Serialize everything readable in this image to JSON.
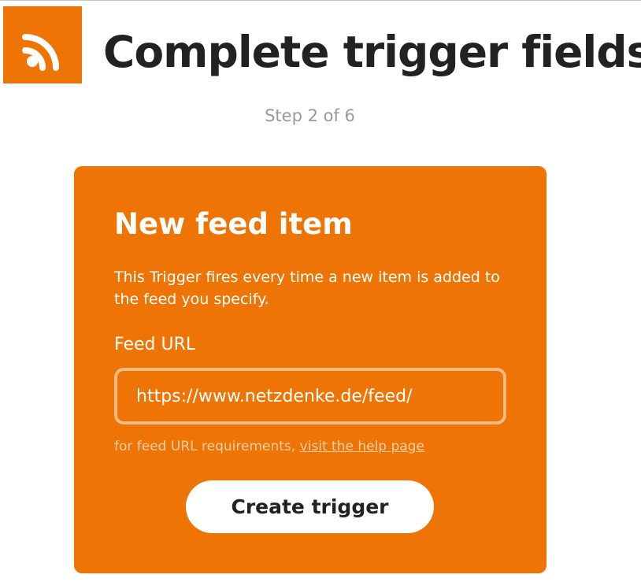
{
  "header": {
    "logo_icon": "rss-feed-icon",
    "title": "Complete trigger fields",
    "step": "Step 2 of 6"
  },
  "colors": {
    "brand": "#ee7505",
    "title_text": "#222222",
    "step_text": "#999999",
    "input_border": "#f7bb83",
    "help_text": "#f9cfa6",
    "spellcheck_underline": "#d9001b"
  },
  "trigger_card": {
    "title": "New feed item",
    "description": "This Trigger fires every time a new item is added to the feed you specify.",
    "field_label": "Feed URL",
    "feed_url_value": "https://www.netzdenke.de/feed/",
    "help_prefix": "for feed URL requirements, ",
    "help_link_label": "visit the help page",
    "create_button_label": "Create trigger"
  }
}
